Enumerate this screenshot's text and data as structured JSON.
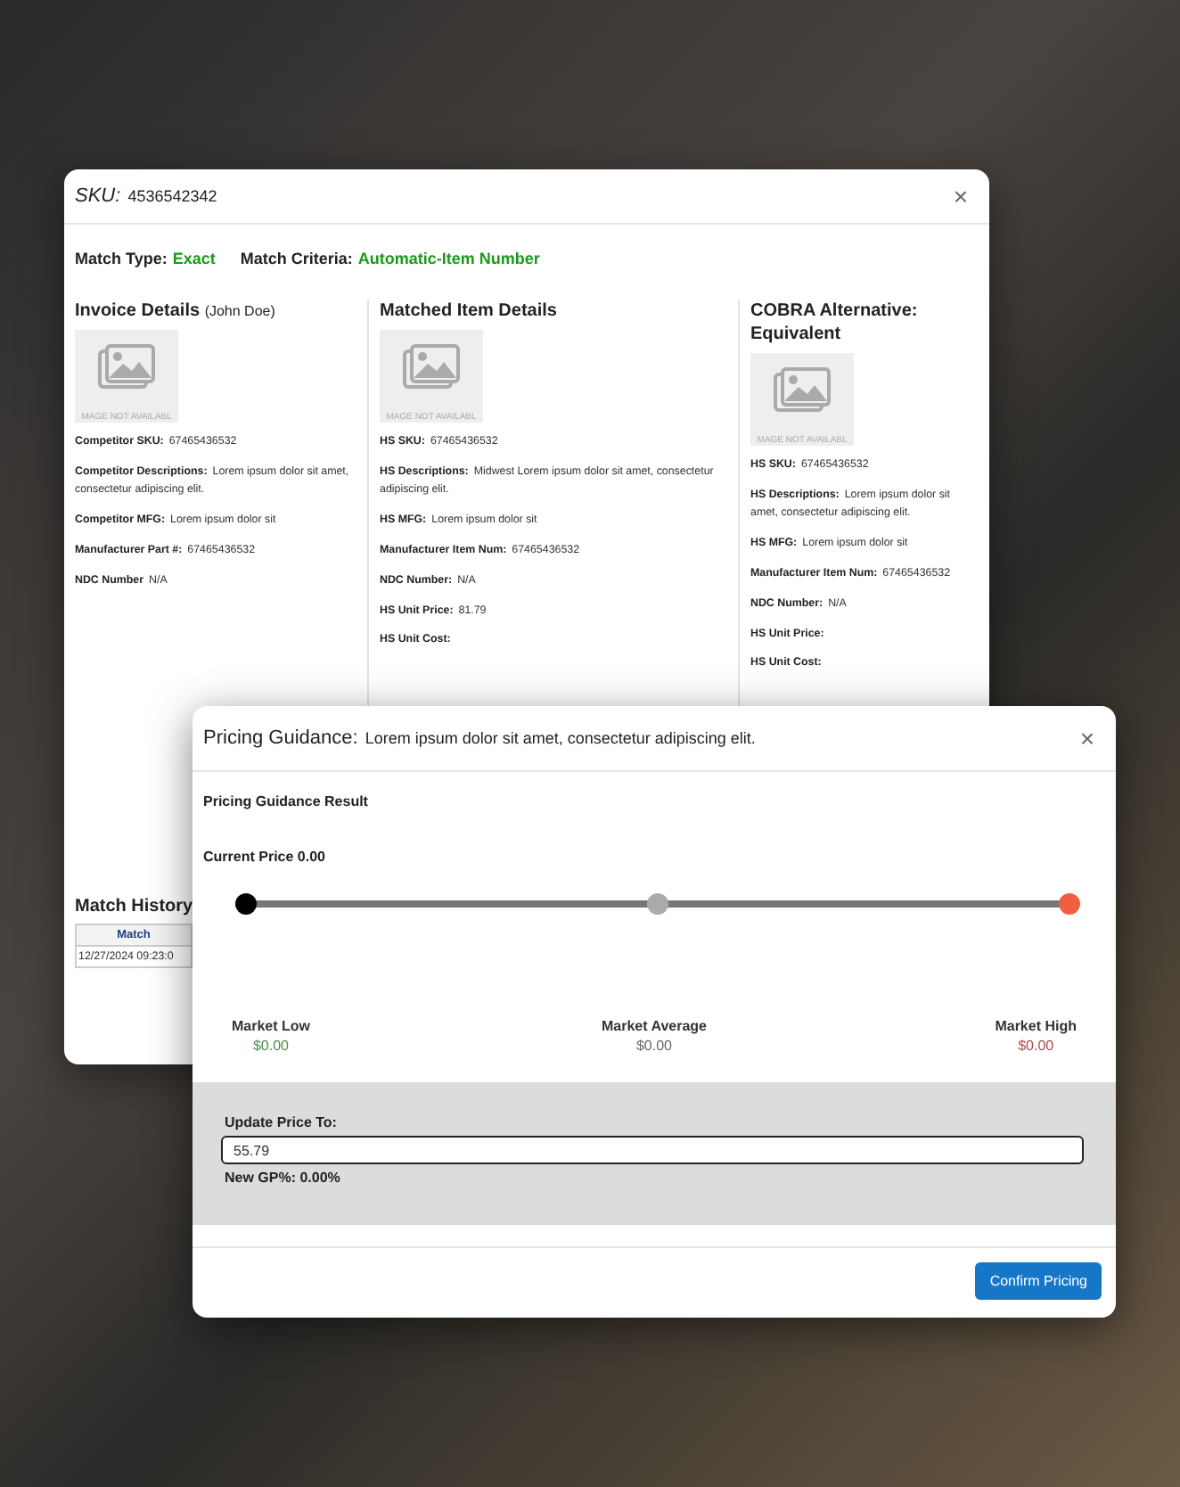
{
  "sku_dialog": {
    "title_label": "SKU:",
    "title_value": "4536542342",
    "close": "×",
    "match_type": {
      "label": "Match Type:",
      "value": "Exact"
    },
    "match_criteria": {
      "label": "Match Criteria:",
      "value": "Automatic-Item Number"
    },
    "columns": [
      {
        "title": "Invoice Details",
        "subtitle": "(John Doe)",
        "image_caption": "MAGE NOT AVAILABL",
        "fields": [
          {
            "label": "Competitor SKU:",
            "value": "67465436532"
          },
          {
            "label": "Competitor Descriptions:",
            "value": "Lorem ipsum dolor sit amet, consectetur adipiscing elit."
          },
          {
            "label": "Competitor MFG:",
            "value": "Lorem ipsum dolor sit"
          },
          {
            "label": "Manufacturer Part #:",
            "value": "67465436532"
          },
          {
            "label": "NDC Number",
            "value": "N/A"
          }
        ]
      },
      {
        "title": "Matched Item Details",
        "image_caption": "MAGE NOT AVAILABL",
        "fields": [
          {
            "label": "HS SKU:",
            "value": "67465436532"
          },
          {
            "label": "HS Descriptions:",
            "value": "Midwest Lorem ipsum dolor sit amet, consectetur adipiscing elit."
          },
          {
            "label": "HS MFG:",
            "value": "Lorem ipsum dolor sit"
          },
          {
            "label": "Manufacturer Item Num:",
            "value": "67465436532"
          },
          {
            "label": "NDC Number:",
            "value": "N/A"
          },
          {
            "label": "HS Unit Price:",
            "value": "81.79"
          },
          {
            "label": "HS Unit Cost:"
          }
        ]
      },
      {
        "title": "COBRA Alternative: Equivalent",
        "image_caption": "MAGE NOT AVAILABL",
        "fields": [
          {
            "label": "HS SKU:",
            "value": "67465436532"
          },
          {
            "label": "HS Descriptions:",
            "value": "Lorem ipsum dolor sit amet, consectetur adipiscing elit."
          },
          {
            "label": "HS MFG:",
            "value": "Lorem ipsum dolor sit"
          },
          {
            "label": "Manufacturer Item Num:",
            "value": "67465436532"
          },
          {
            "label": "NDC Number:",
            "value": "N/A"
          },
          {
            "label": "HS Unit Price:"
          },
          {
            "label": "HS Unit Cost:"
          }
        ]
      }
    ],
    "match_history": {
      "title": "Match History",
      "columns": [
        "Match"
      ],
      "rows": [
        [
          "12/27/2024 09:23:0"
        ]
      ]
    }
  },
  "pricing_dialog": {
    "title": "Pricing Guidance:",
    "description": "Lorem ipsum dolor sit amet, consectetur adipiscing elit.",
    "close": "×",
    "result_title": "Pricing Guidance Result",
    "current_price": "Current Price 0.00",
    "slider": {
      "level": 0
    },
    "markets": [
      {
        "label": "Market Low",
        "value": "$0.00",
        "color": "#4f8a4f"
      },
      {
        "label": "Market Average",
        "value": "$0.00",
        "color": "#666666"
      },
      {
        "label": "Market High",
        "value": "$0.00",
        "color": "#b04a4a"
      }
    ],
    "update_label": "Update Price To:",
    "update_value": "55.79",
    "new_gp": "New GP%: 0.00%",
    "confirm_button": "Confirm Pricing"
  }
}
